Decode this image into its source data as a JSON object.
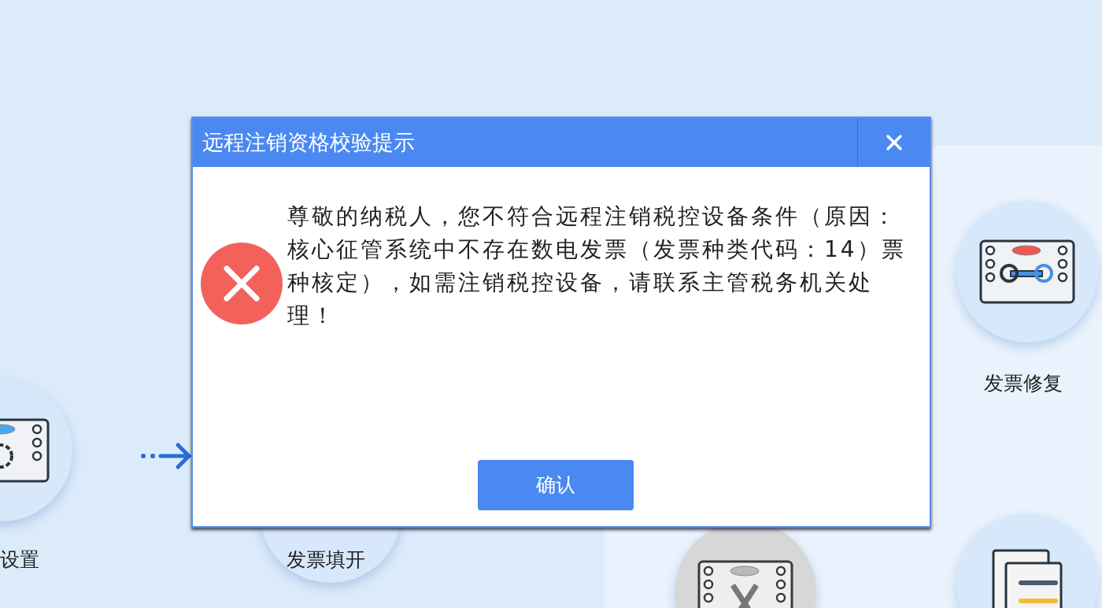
{
  "tiles": [
    {
      "kind": "settings",
      "label": "设置",
      "disabled": false
    },
    {
      "kind": "issue",
      "label": "发票填开",
      "disabled": false
    },
    {
      "kind": "repair",
      "label": "发票修复",
      "disabled": false
    },
    {
      "kind": "cancel",
      "disabled": true
    },
    {
      "kind": "document",
      "disabled": false
    }
  ],
  "dialog": {
    "title": "远程注销资格校验提示",
    "message": "尊敬的纳税人，您不符合远程注销税控设备条件（原因：核心征管系统中不存在数电发票（发票种类代码：14）票种核定），如需注销税控设备，请联系主管税务机关处理！",
    "confirm_button": "确认"
  }
}
